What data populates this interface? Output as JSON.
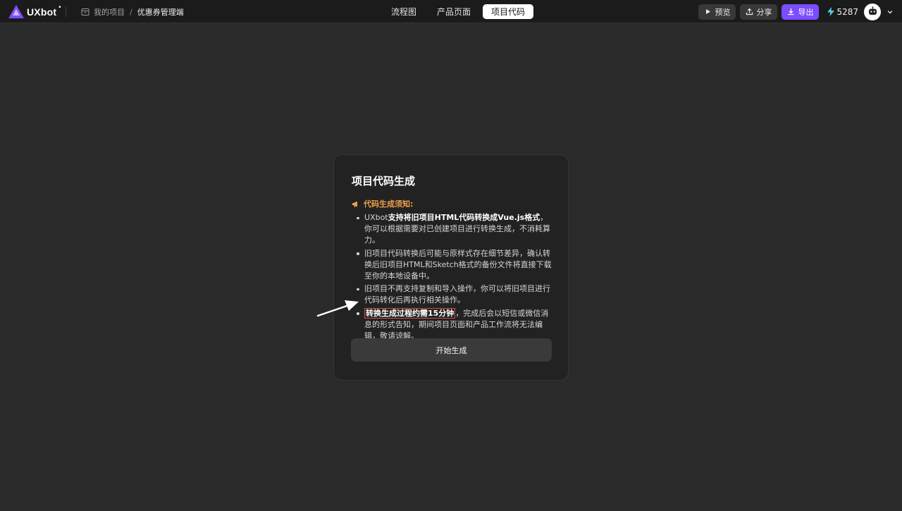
{
  "app": {
    "logo_text": "UXbot",
    "logo_dot": "•"
  },
  "breadcrumb": {
    "parent": "我的项目",
    "separator": "/",
    "current": "优惠券管理端"
  },
  "tabs": [
    {
      "label": "流程图",
      "active": false
    },
    {
      "label": "产品页面",
      "active": false
    },
    {
      "label": "项目代码",
      "active": true
    }
  ],
  "actions": {
    "preview_label": "预览",
    "share_label": "分享",
    "export_label": "导出",
    "credits": "5287"
  },
  "modal": {
    "title": "项目代码生成",
    "notice_title": "代码生成须知:",
    "items": [
      {
        "prefix": "UXbot",
        "bold": "支持将旧项目HTML代码转换成Vue.js格式",
        "rest": "，你可以根据需要对已创建项目进行转换生成，不消耗算力。"
      },
      {
        "text": "旧项目代码转换后可能与原样式存在细节差异，确认转换后旧项目HTML和Sketch格式的备份文件将直接下载至你的本地设备中。"
      },
      {
        "text": "旧项目不再支持复制和导入操作，你可以将旧项目进行代码转化后再执行相关操作。"
      },
      {
        "bold": "转换生成过程约需15分钟",
        "rest": "，完成后会以短信或微信消息的形式告知，期间项目页面和产品工作流将无法编辑，敬请谅解。"
      }
    ],
    "start_button": "开始生成"
  },
  "colors": {
    "accent": "#7c4dff",
    "notice": "#f0a04b",
    "highlight": "#d94a4a"
  }
}
